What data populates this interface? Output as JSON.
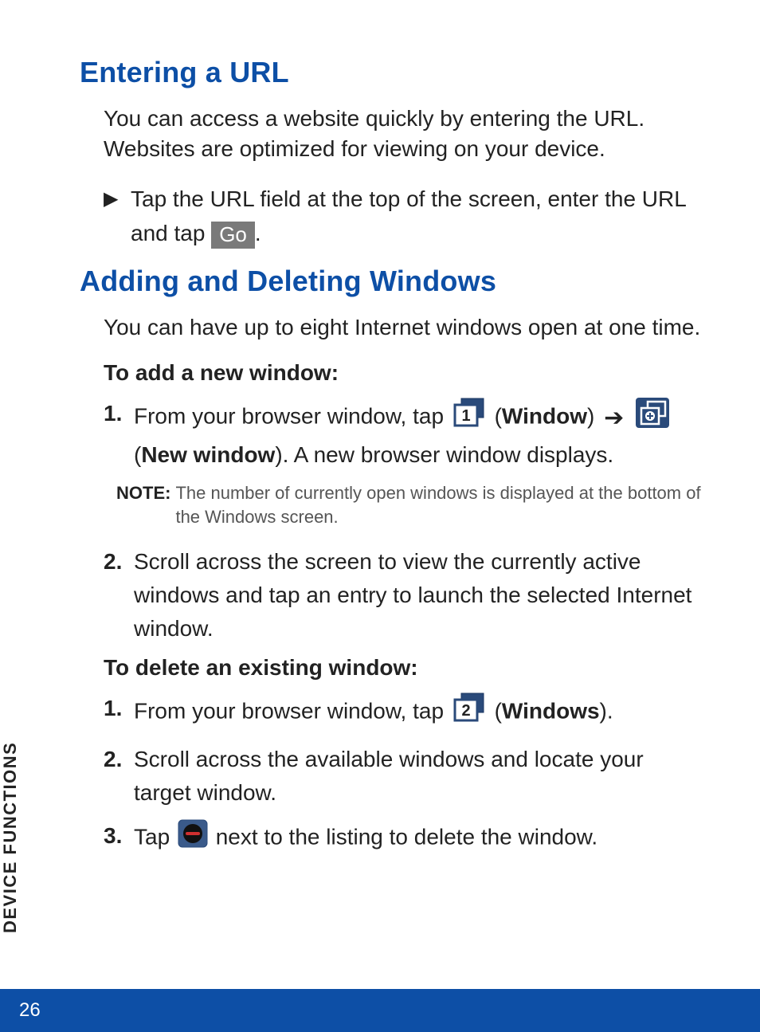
{
  "section1": {
    "heading": "Entering a URL",
    "intro": "You can access a website quickly by entering the URL. Websites are optimized for viewing on your device.",
    "bullet": {
      "text_before": "Tap the URL field at the top of the screen, enter the URL and tap ",
      "go_label": "Go",
      "text_after": "."
    }
  },
  "section2": {
    "heading": "Adding and Deleting Windows",
    "intro": "You can have up to eight Internet windows open at one time.",
    "add": {
      "sub": "To add a new window:",
      "step1": {
        "num": "1.",
        "a": "From your browser window, tap ",
        "b": " (",
        "c": "Window",
        "d": ") ",
        "e": " (",
        "f": "New window",
        "g": "). A new browser window displays."
      },
      "note_label": "NOTE:",
      "note_text": "The number of currently open windows is displayed at the bottom of the Windows screen.",
      "step2": {
        "num": "2.",
        "text": "Scroll across the screen to view the currently active windows and tap an entry to launch the selected Internet window."
      }
    },
    "del": {
      "sub": "To delete an existing window:",
      "step1": {
        "num": "1.",
        "a": "From your browser window, tap ",
        "b": " (",
        "c": "Windows",
        "d": ")."
      },
      "step2": {
        "num": "2.",
        "text": "Scroll across the available windows and locate your target window."
      },
      "step3": {
        "num": "3.",
        "a": "Tap ",
        "b": " next to the listing to delete the window."
      }
    }
  },
  "side_label": "DEVICE FUNCTIONS",
  "page_number": "26",
  "icons": {
    "window1_digit": "1",
    "window2_digit": "2"
  }
}
